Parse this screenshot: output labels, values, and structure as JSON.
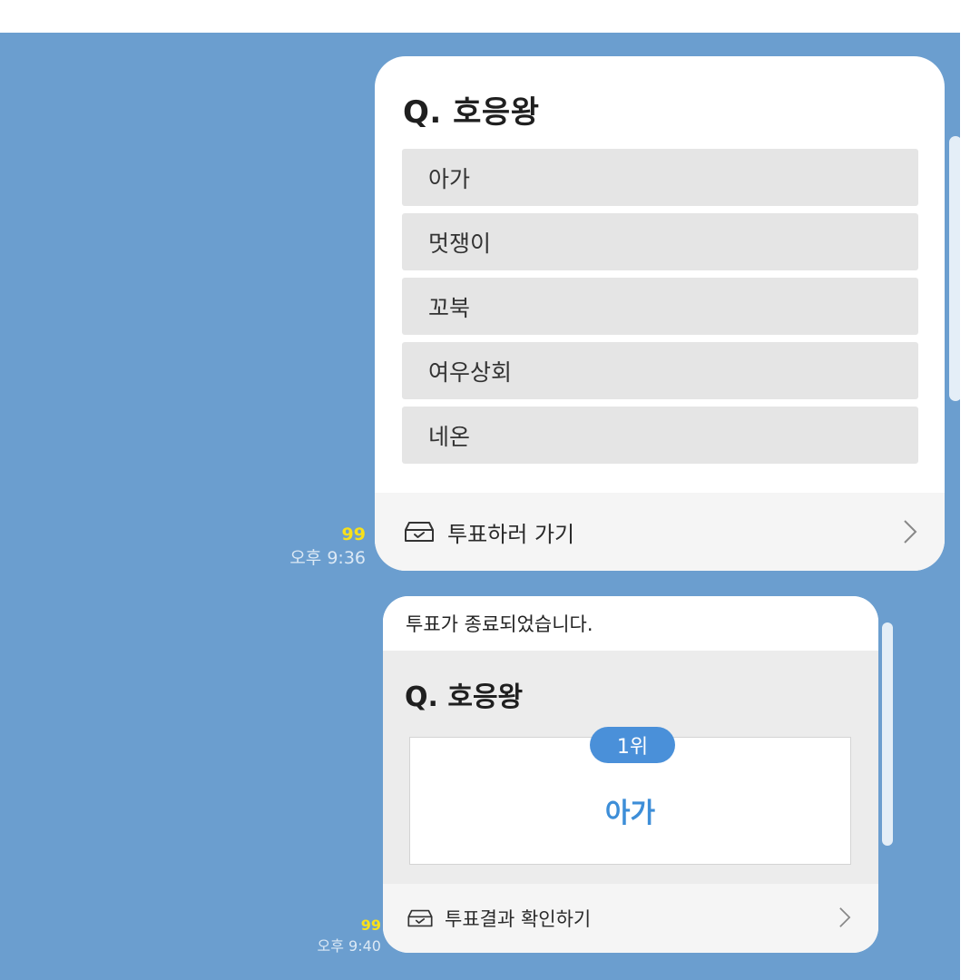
{
  "poll": {
    "question": "Q. 호응왕",
    "options": [
      "아가",
      "멋쟁이",
      "꼬북",
      "여우상회",
      "네온"
    ],
    "action_label": "투표하러 가기",
    "message_count": "99",
    "time": "오후 9:36"
  },
  "result": {
    "ended_text": "투표가 종료되었습니다.",
    "question": "Q. 호응왕",
    "rank_label": "1위",
    "winner": "아가",
    "action_label": "투표결과 확인하기",
    "message_count": "99",
    "time": "오후 9:40"
  },
  "icons": {
    "ballot": "ballot-box-icon",
    "chevron": "chevron-right-icon"
  },
  "colors": {
    "chat_background": "#6b9ecf",
    "badge": "#4a90d9",
    "winner_text": "#3d8ed8",
    "count_yellow": "#f7e01b"
  }
}
